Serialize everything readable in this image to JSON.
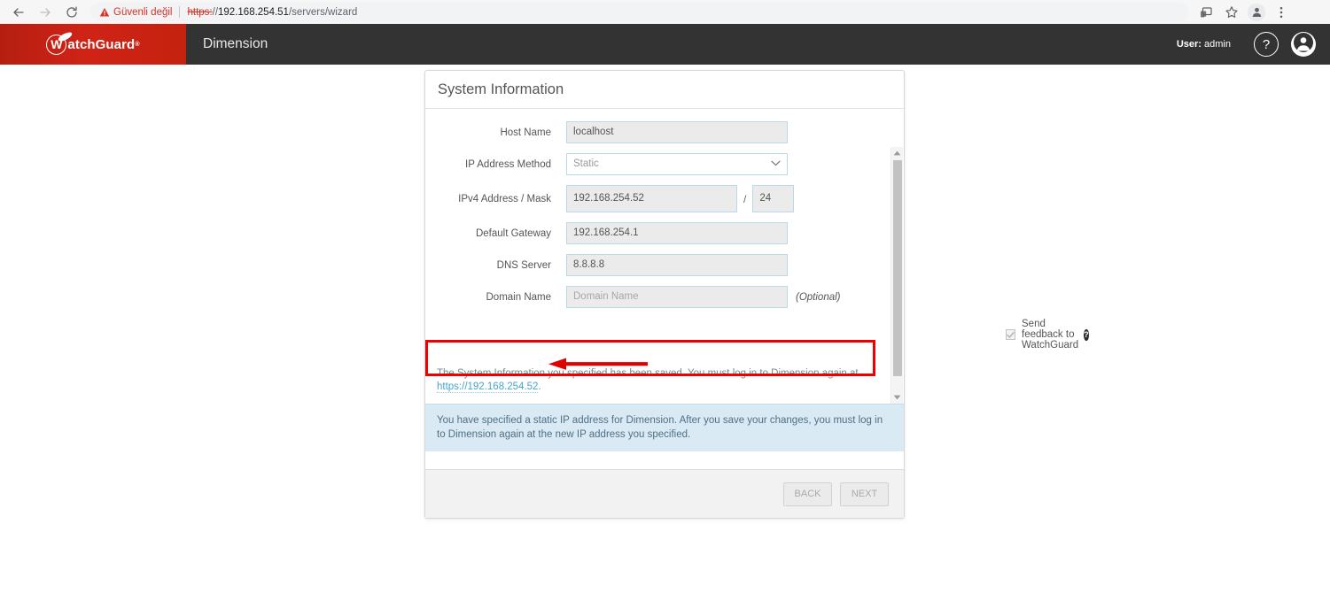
{
  "browser": {
    "back_icon": "arrow-left-icon",
    "forward_icon": "arrow-right-icon",
    "reload_icon": "reload-icon",
    "security_icon": "warning-triangle-icon",
    "security_label": "Güvenli değil",
    "url_scheme": "https:",
    "url_separator": "//",
    "url_host": "192.168.254.51",
    "url_path": "/servers/wizard",
    "cast_icon": "cast-icon",
    "bookmark_icon": "star-icon",
    "profile_icon": "profile-avatar-icon",
    "menu_icon": "three-dots-menu-icon"
  },
  "header": {
    "logo_letter": "W",
    "logo_name": "atchGuard",
    "logo_reg": "®",
    "app_title": "Dimension",
    "user_label": "User:",
    "user_name": "admin",
    "help_icon_glyph": "?",
    "account_icon": "user-avatar-icon"
  },
  "card": {
    "title": "System Information",
    "fields": [
      {
        "label": "Host Name",
        "value": "localhost"
      },
      {
        "label": "IP Address Method",
        "value": "Static"
      },
      {
        "label": "IPv4 Address / Mask",
        "value": "192.168.254.52",
        "separator": "/",
        "mask": "24"
      },
      {
        "label": "Default Gateway",
        "value": "192.168.254.1"
      },
      {
        "label": "DNS Server",
        "value": "8.8.8.8"
      },
      {
        "label": "Domain Name",
        "placeholder": "Domain Name",
        "optional": "(Optional)"
      }
    ],
    "checkbox": {
      "label": "Send feedback to WatchGuard",
      "checked": true,
      "help_glyph": "?"
    },
    "saved_message": {
      "text_before": "The System Information you specified has been saved. You must log in to Dimension again at ",
      "link": "https://192.168.254.52",
      "text_after": "."
    },
    "info_panel": "You have specified a static IP address for Dimension. After you save your changes, you must log in to Dimension again at the new IP address you specified.",
    "buttons": {
      "back": "BACK",
      "next": "NEXT"
    }
  },
  "annotation": {
    "box_color": "#ee0000",
    "arrow_color": "#e00000",
    "arrow_direction": "left"
  }
}
